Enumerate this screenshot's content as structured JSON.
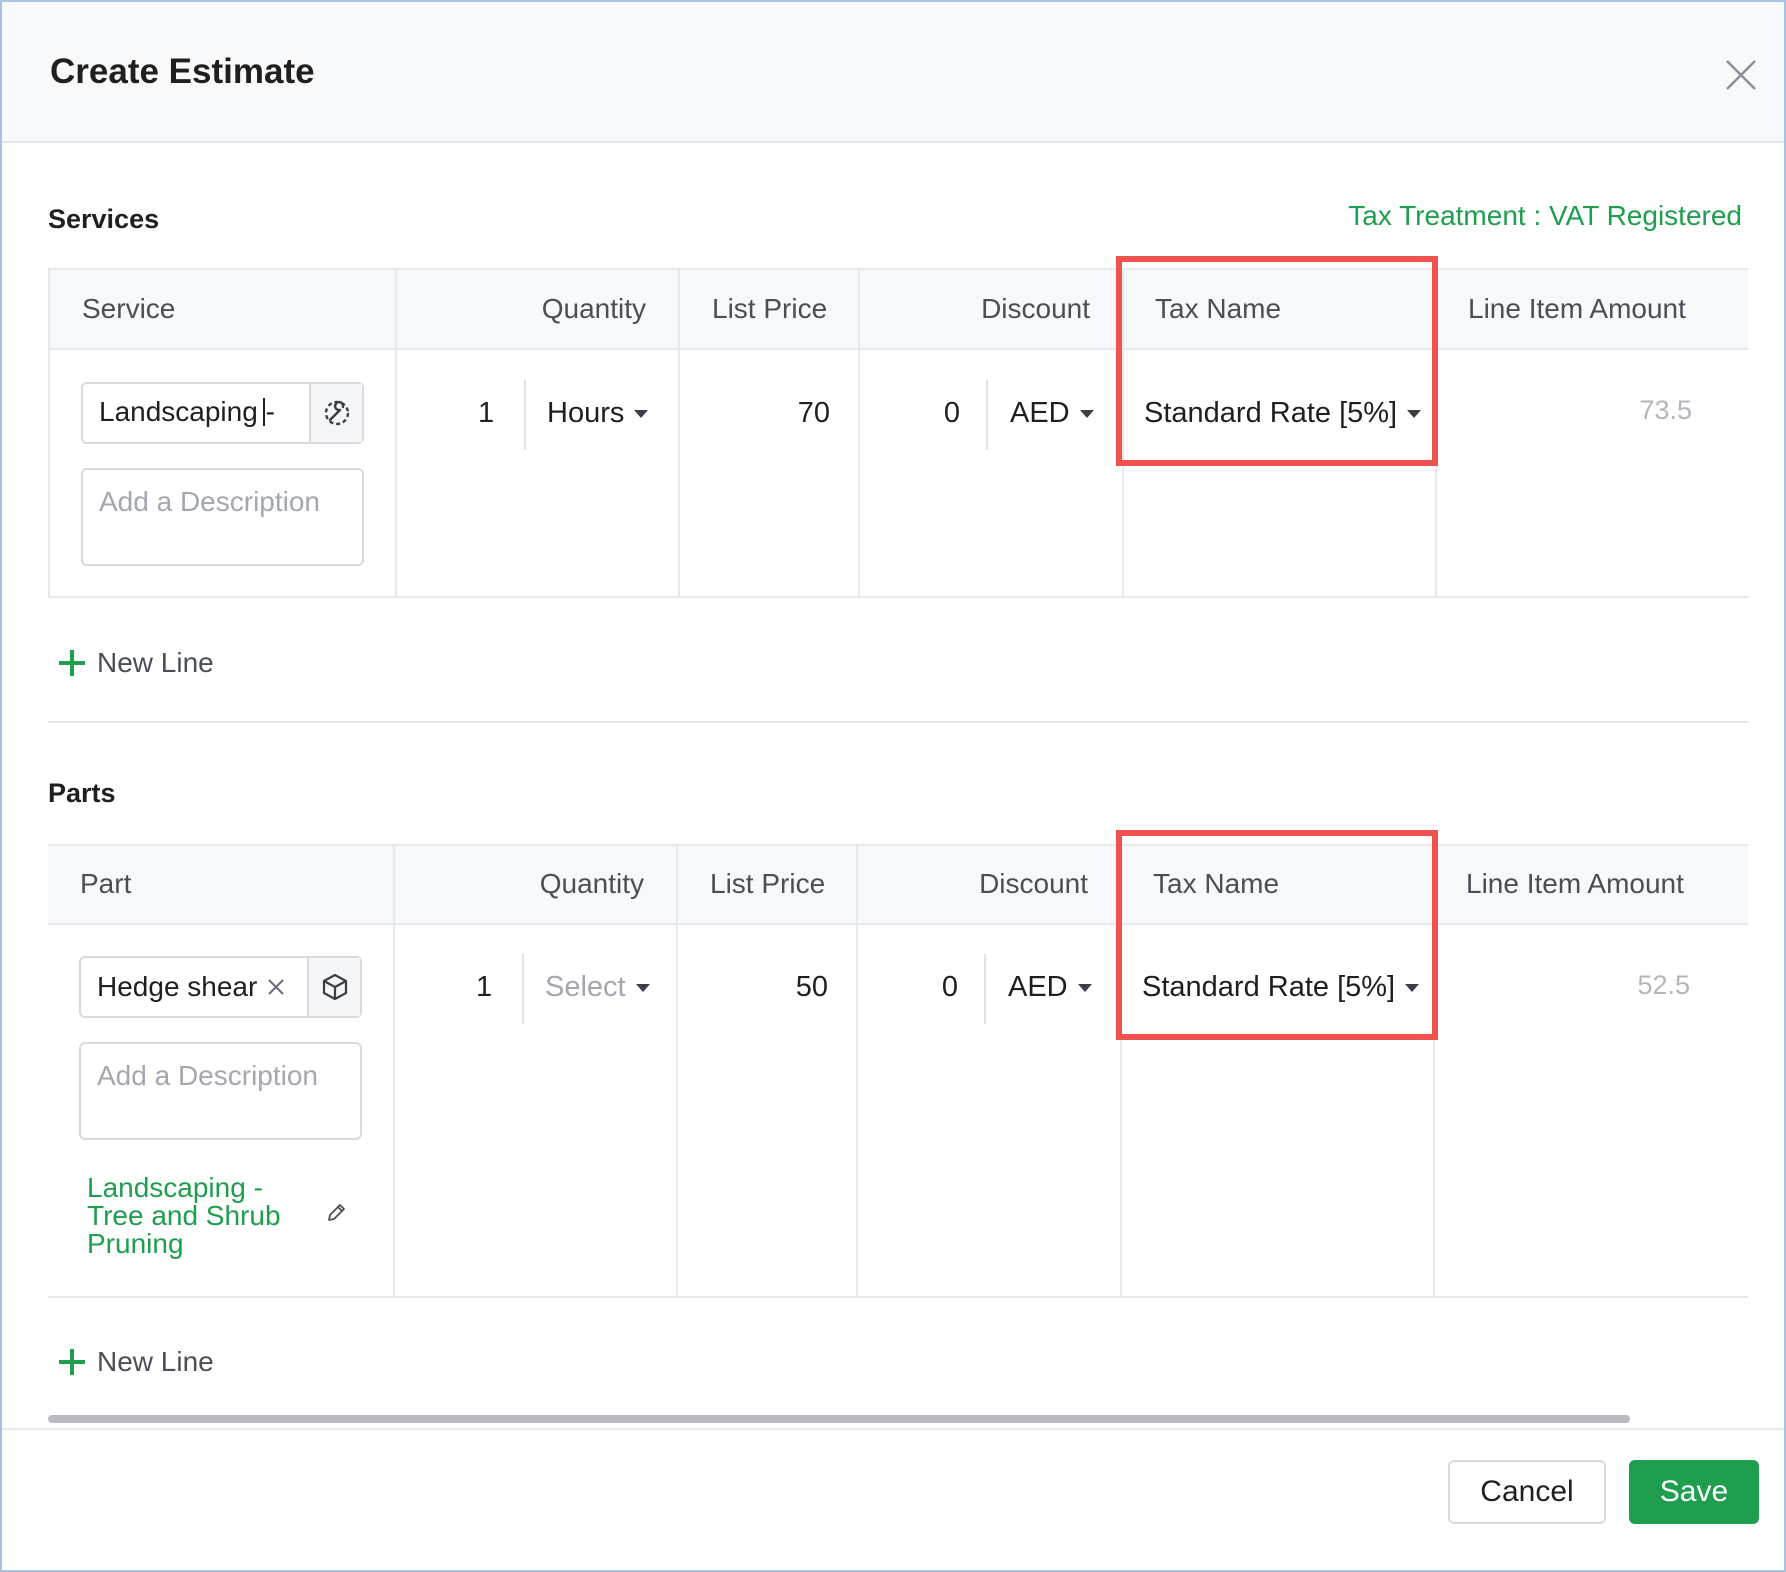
{
  "dialog": {
    "title": "Create Estimate"
  },
  "services": {
    "title": "Services",
    "tax_treatment": "Tax Treatment : VAT Registered",
    "columns": [
      "Service",
      "Quantity",
      "List Price",
      "Discount",
      "Tax Name",
      "Line Item Amount"
    ],
    "row": {
      "item": "Landscaping -",
      "item_icon": "wrench-gear-icon",
      "description_placeholder": "Add a Description",
      "quantity": "1",
      "unit": "Hours",
      "list_price": "70",
      "discount": "0",
      "discount_currency": "AED",
      "tax_name": "Standard Rate [5%]",
      "line_item_amount": "73.5"
    },
    "new_line": "New Line"
  },
  "parts": {
    "title": "Parts",
    "columns": [
      "Part",
      "Quantity",
      "List Price",
      "Discount",
      "Tax Name",
      "Line Item Amount"
    ],
    "row": {
      "item": "Hedge shear",
      "item_icon": "box-icon",
      "description_placeholder": "Add a Description",
      "linked_service": [
        "Landscaping -",
        "Tree and Shrub",
        "Pruning"
      ],
      "quantity": "1",
      "unit_placeholder": "Select",
      "list_price": "50",
      "discount": "0",
      "discount_currency": "AED",
      "tax_name": "Standard Rate [5%]",
      "line_item_amount": "52.5"
    },
    "new_line": "New Line"
  },
  "footer": {
    "cancel_label": "Cancel",
    "save_label": "Save"
  },
  "colors": {
    "accent": "#1e9e4e",
    "highlight": "#f0534e"
  }
}
